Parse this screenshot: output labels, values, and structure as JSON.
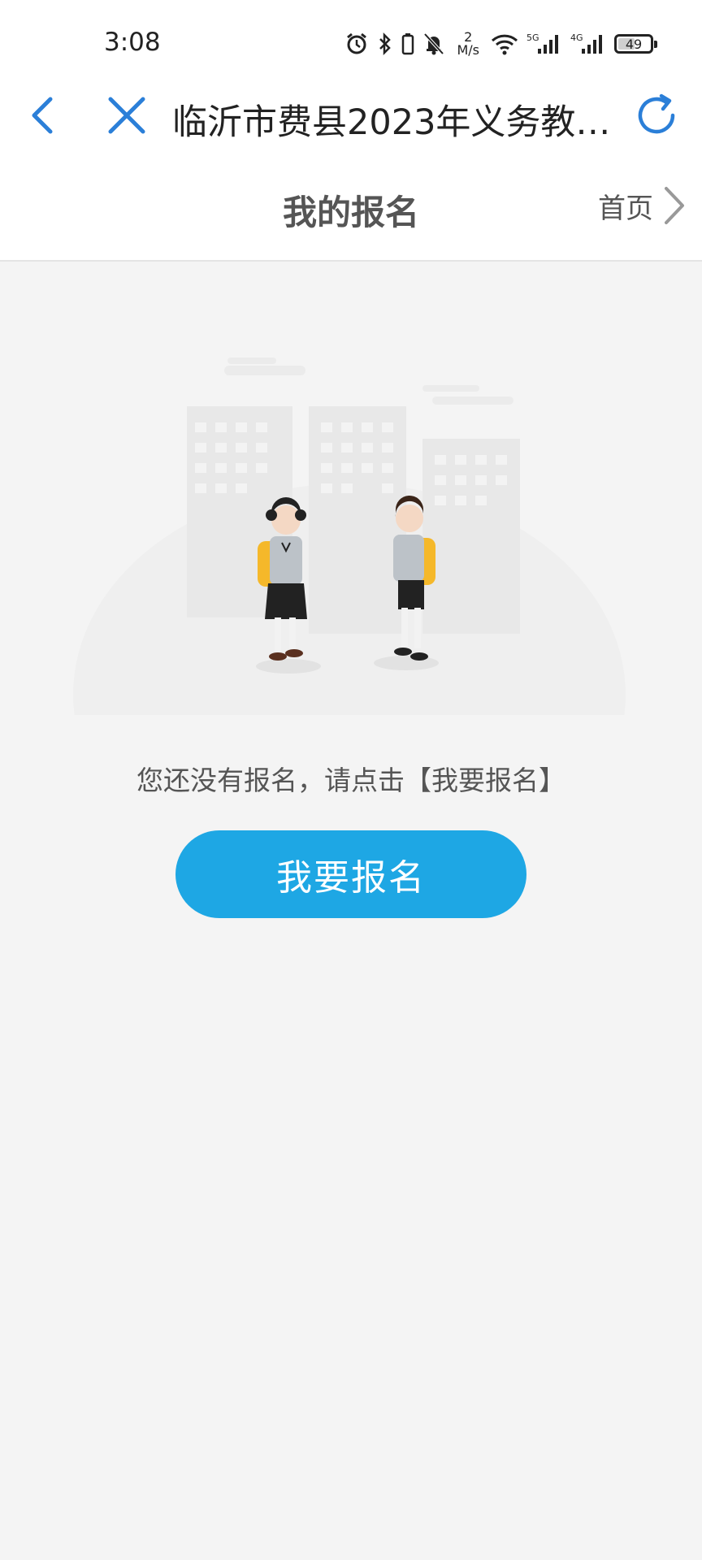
{
  "status_bar": {
    "time": "3:08",
    "net_speed_value": "2",
    "net_speed_unit": "M/s",
    "signal_1_label": "5G",
    "signal_2_label": "4G",
    "battery_level": "49"
  },
  "nav": {
    "title": "临沂市费县2023年义务教…",
    "icons": {
      "back": "chevron-left-icon",
      "close": "close-icon",
      "refresh": "refresh-icon"
    }
  },
  "page": {
    "title": "我的报名",
    "home_label": "首页"
  },
  "empty_state": {
    "message": "您还没有报名，请点击【我要报名】",
    "button_label": "我要报名"
  },
  "colors": {
    "accent": "#1ea7e4",
    "nav_icon": "#2b7fd8",
    "background": "#f4f4f4"
  }
}
